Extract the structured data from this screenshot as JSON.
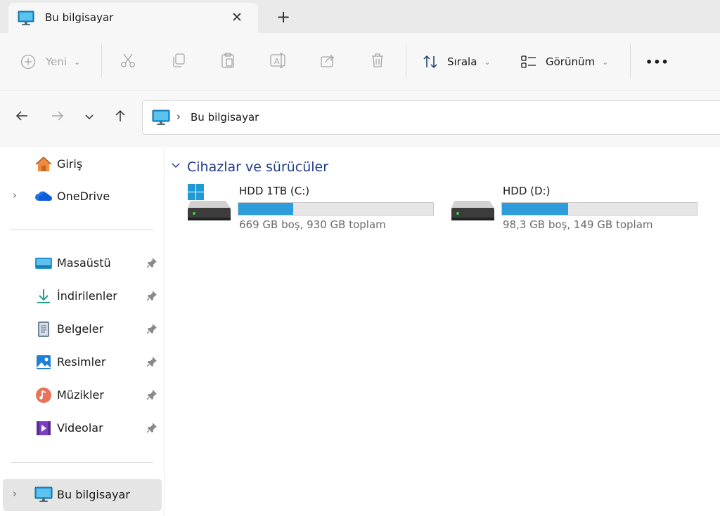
{
  "tab": {
    "title": "Bu bilgisayar",
    "close_glyph": "✕",
    "new_glyph": "+"
  },
  "toolbar": {
    "new_label": "Yeni",
    "sort_label": "Sırala",
    "view_label": "Görünüm",
    "more_glyph": "•••"
  },
  "address": {
    "crumb": "Bu bilgisayar",
    "separator": "›"
  },
  "sidebar": {
    "home": "Giriş",
    "onedrive": "OneDrive",
    "pinned": [
      {
        "label": "Masaüstü",
        "icon": "desktop-folder-icon"
      },
      {
        "label": "İndirilenler",
        "icon": "downloads-folder-icon"
      },
      {
        "label": "Belgeler",
        "icon": "documents-folder-icon"
      },
      {
        "label": "Resimler",
        "icon": "pictures-folder-icon"
      },
      {
        "label": "Müzikler",
        "icon": "music-folder-icon"
      },
      {
        "label": "Videolar",
        "icon": "videos-folder-icon"
      }
    ],
    "this_pc": "Bu bilgisayar"
  },
  "main": {
    "section_title": "Cihazlar ve sürücüler",
    "drives": [
      {
        "name": "HDD 1TB (C:)",
        "free_text": "669 GB boş, 930 GB toplam",
        "used_fraction": 0.28,
        "system_drive": true
      },
      {
        "name": "HDD (D:)",
        "free_text": "98,3 GB boş, 149 GB toplam",
        "used_fraction": 0.34,
        "system_drive": false
      }
    ]
  },
  "colors": {
    "accent": "#2d9cdb",
    "section_header": "#1f3c88",
    "selection": "#e5e5e5"
  }
}
